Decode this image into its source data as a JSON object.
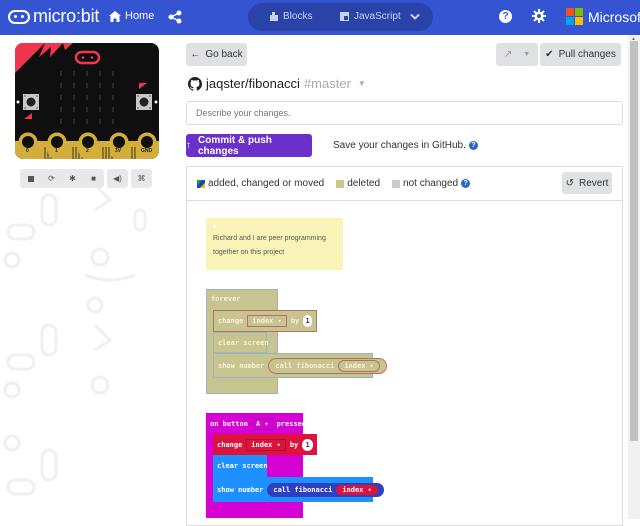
{
  "header": {
    "brand": "micro:bit",
    "home_label": "Home",
    "editor_modes": {
      "blocks_label": "Blocks",
      "javascript_label": "JavaScript"
    },
    "help_glyph": "?",
    "vendor": "Microsoft",
    "colors": {
      "bar": "#3454D1",
      "toggle": "#2A43A8"
    }
  },
  "simulator": {
    "pins": [
      "0",
      "1",
      "2",
      "3V",
      "GND"
    ],
    "button_a": "A",
    "button_b": "B",
    "controls": [
      "stop-icon",
      "restart-icon",
      "debug-icon",
      "screenshot-icon",
      "mute-icon",
      "fullscreen-icon"
    ]
  },
  "github": {
    "go_back_label": "Go back",
    "pull_label": "Pull changes",
    "repo": "jaqster/fibonacci",
    "branch": "#master",
    "description_placeholder": "Describe your changes.",
    "commit_label": "Commit & push changes",
    "save_note": "Save your changes in GitHub.",
    "commit_color": "#6A30C8"
  },
  "diff": {
    "legend": {
      "added": "added, changed or moved",
      "deleted": "deleted",
      "not_changed": "not changed"
    },
    "revert_label": "Revert",
    "comment": "Richard and I are peer programming together on this project",
    "deleted_block": {
      "hat": "forever",
      "change": "change",
      "var": "index ▾",
      "by": "by",
      "amount": "1",
      "clear": "clear screen",
      "show": "show number",
      "call": "call fibonacci",
      "arg": "index ▾"
    },
    "added_block": {
      "hat_prefix": "on button",
      "button": "A ▾",
      "hat_suffix": "pressed",
      "change": "change",
      "var": "index ▾",
      "by": "by",
      "amount": "1",
      "clear": "clear screen",
      "show": "show number",
      "call": "call fibonacci",
      "arg": "index ▾"
    }
  }
}
